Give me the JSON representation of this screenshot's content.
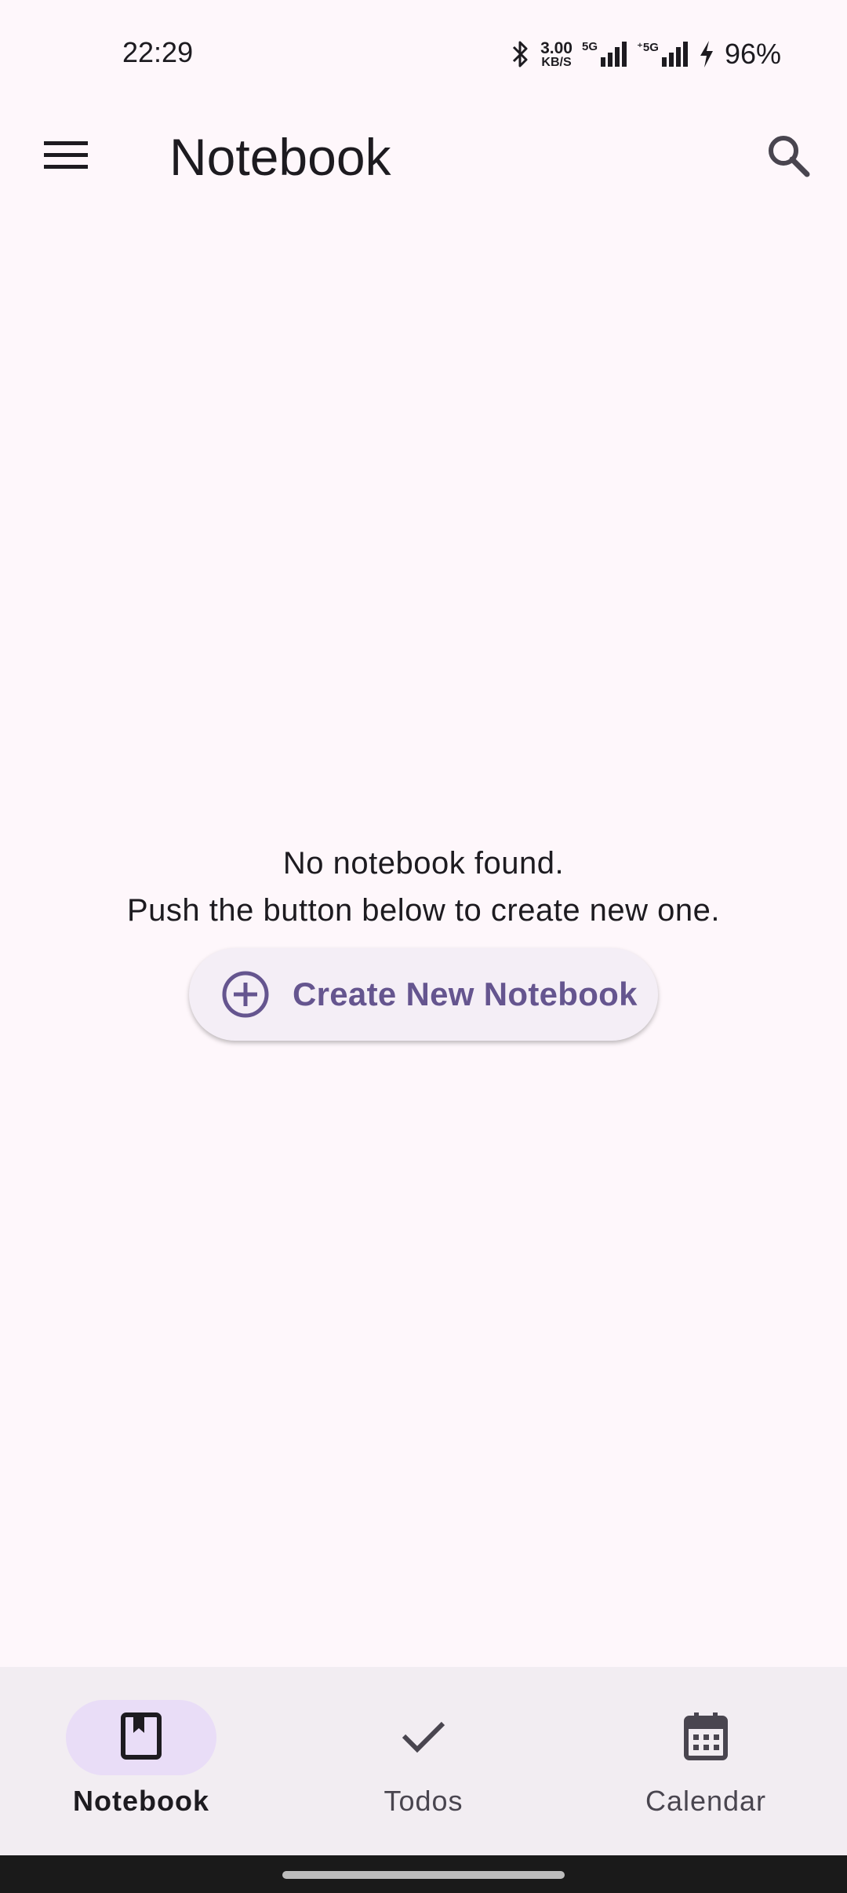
{
  "status_bar": {
    "time": "22:29",
    "net_speed_value": "3.00",
    "net_speed_unit": "KB/S",
    "sim1_label": "5G",
    "sim2_label": "5G",
    "battery": "96%",
    "icons": [
      "bluetooth-icon",
      "signal-icon",
      "signal-icon",
      "charging-icon"
    ]
  },
  "app_bar": {
    "title": "Notebook",
    "menu_icon": "menu-icon",
    "search_icon": "search-icon"
  },
  "empty_state": {
    "line1": "No notebook found.",
    "line2": "Push the button below to create new one.",
    "button_label": "Create New Notebook",
    "button_icon": "add-circle-icon"
  },
  "bottom_nav": {
    "items": [
      {
        "label": "Notebook",
        "icon": "notebook-icon",
        "active": true
      },
      {
        "label": "Todos",
        "icon": "check-icon",
        "active": false
      },
      {
        "label": "Calendar",
        "icon": "calendar-icon",
        "active": false
      }
    ]
  },
  "colors": {
    "background": "#FEF7FB",
    "accent": "#65558F",
    "nav_background": "#F2EDF2",
    "nav_indicator": "#E9DDF7"
  }
}
